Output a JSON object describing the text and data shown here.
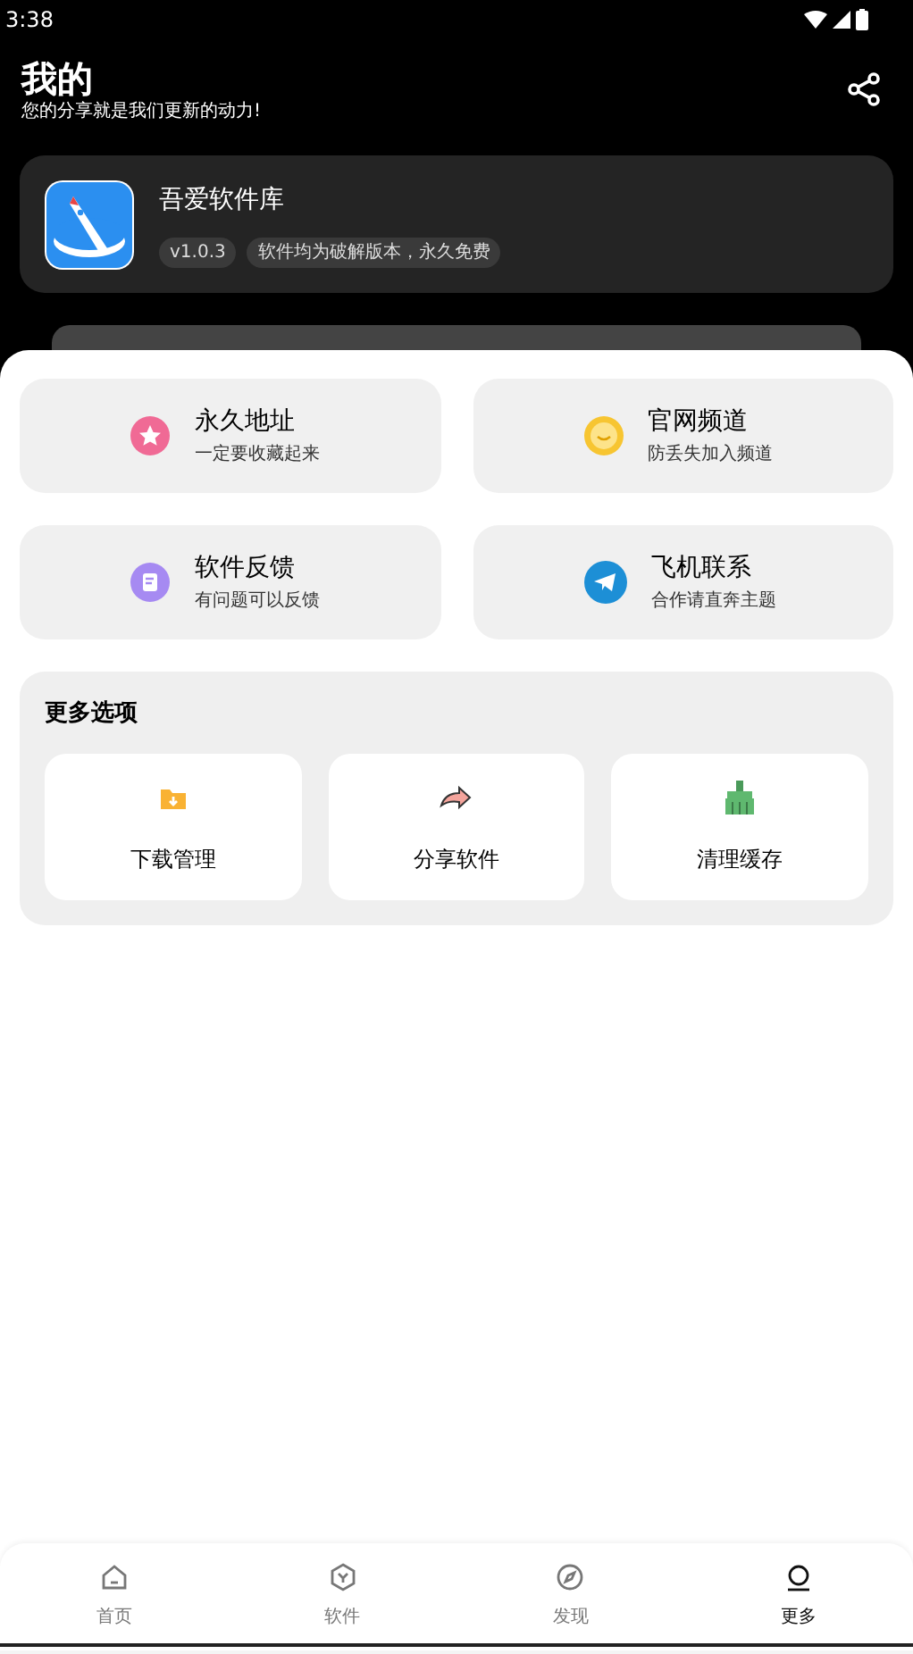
{
  "status_bar": {
    "time": "3:38"
  },
  "header": {
    "title": "我的",
    "subtitle": "您的分享就是我们更新的动力!"
  },
  "app_card": {
    "name": "吾爱软件库",
    "version": "v1.0.3",
    "tagline": "软件均为破解版本，永久免费"
  },
  "links": [
    {
      "kind": "star",
      "title": "永久地址",
      "subtitle": "一定要收藏起来"
    },
    {
      "kind": "smile",
      "title": "官网频道",
      "subtitle": "防丢失加入频道"
    },
    {
      "kind": "feedback",
      "title": "软件反馈",
      "subtitle": "有问题可以反馈"
    },
    {
      "kind": "telegram",
      "title": "飞机联系",
      "subtitle": "合作请直奔主题"
    }
  ],
  "more_options": {
    "title": "更多选项",
    "items": [
      {
        "kind": "download",
        "label": "下载管理"
      },
      {
        "kind": "share",
        "label": "分享软件"
      },
      {
        "kind": "clean",
        "label": "清理缓存"
      }
    ]
  },
  "bottom_nav": [
    {
      "kind": "home",
      "label": "首页",
      "selected": false
    },
    {
      "kind": "software",
      "label": "软件",
      "selected": false
    },
    {
      "kind": "discover",
      "label": "发现",
      "selected": false
    },
    {
      "kind": "more",
      "label": "更多",
      "selected": true
    }
  ]
}
